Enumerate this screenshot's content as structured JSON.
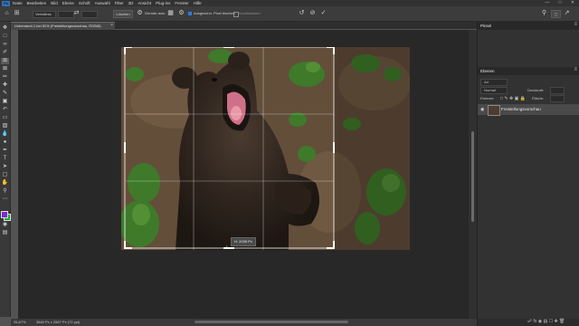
{
  "menubar": {
    "logo": "Ps",
    "items": [
      "Datei",
      "Bearbeiten",
      "Bild",
      "Ebene",
      "Schrift",
      "Auswahl",
      "Filter",
      "3D",
      "Ansicht",
      "Plug-ins",
      "Fenster",
      "Hilfe"
    ]
  },
  "options": {
    "ratio_value": "Verhältnis",
    "clear_button": "Löschen",
    "straighten_label": "Gerade ausr.",
    "delete_cropped_label": "Ausgeschn. Pixel löschen",
    "content_aware_label": "Inhaltsbasiert"
  },
  "document": {
    "tab_title": "Unbenannt-1 bei 51% (Freistellungsvorschau, RGB/8)",
    "size_readout": "H: 2035 Px"
  },
  "status": {
    "zoom": "26,67%",
    "doc_info": "3840 Px x 2567 Px (72 ppi)"
  },
  "panels": {
    "top_title": "Pinsel",
    "layers_title": "Ebenen",
    "kind_label": "Art",
    "normal_label": "Normal",
    "opacity_label": "Deckkraft:",
    "lock_label": "Fixieren:",
    "fill_label": "Fläche:",
    "layer_name": "Freistellungsvorschau"
  },
  "colors": {
    "foreground": "#7a2bd6",
    "background": "#1faa2a",
    "canvas_bg": "#282828"
  }
}
